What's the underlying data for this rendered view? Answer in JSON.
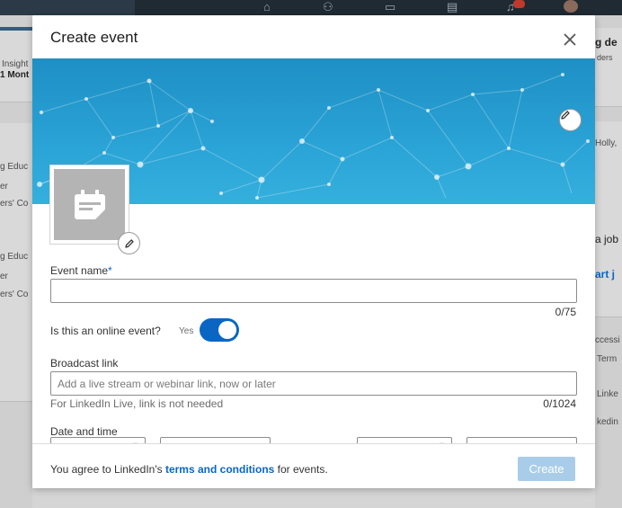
{
  "modal": {
    "title": "Create event",
    "close_icon": "close-icon",
    "banner_edit_icon": "pencil-icon",
    "logo_icon": "calendar-icon",
    "logo_edit_icon": "pencil-icon"
  },
  "form": {
    "event_name": {
      "label": "Event name",
      "required_mark": "*",
      "value": "",
      "counter": "0/75"
    },
    "online_event": {
      "question": "Is this an online event?",
      "toggle_label": "Yes",
      "enabled": true
    },
    "broadcast_link": {
      "label": "Broadcast link",
      "placeholder": "Add a live stream or webinar link, now or later",
      "hint": "For LinkedIn Live, link is not needed",
      "counter": "0/1024"
    },
    "date_time": {
      "label": "Date and time"
    }
  },
  "footer": {
    "agree_prefix": "You agree to LinkedIn's",
    "terms_link": "terms and conditions",
    "agree_suffix": "for events.",
    "create_label": "Create"
  },
  "background": {
    "left_snippets": [
      "Insight",
      "1 Mont",
      "g Educ",
      "er",
      "ers' Co",
      "g Educ",
      "er",
      "ers' Co"
    ],
    "right_snippets": [
      "g de",
      "ders",
      "Holly,",
      "a job",
      "art j",
      "ccessi",
      "Term",
      "Linke",
      "kedin"
    ]
  },
  "colors": {
    "accent": "#0a66c2",
    "banner": "#2aa3d6",
    "create_disabled": "#a9cde9"
  }
}
